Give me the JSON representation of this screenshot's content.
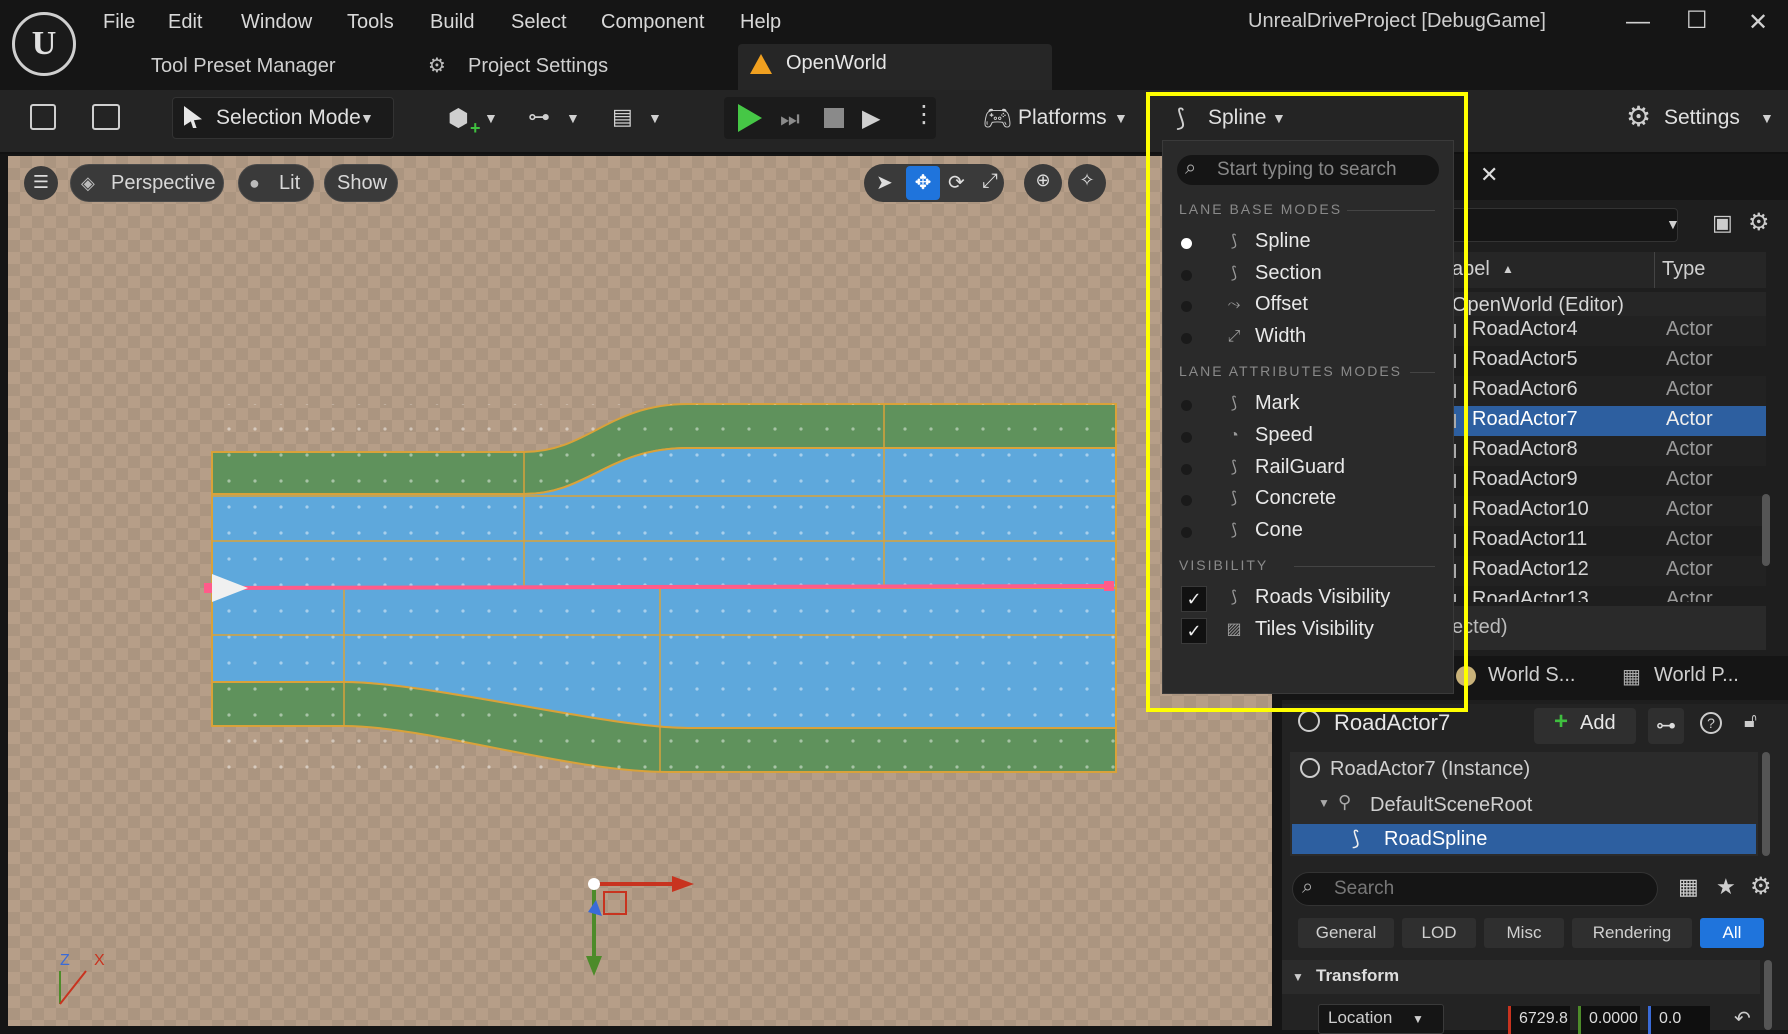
{
  "menu": [
    "File",
    "Edit",
    "Window",
    "Tools",
    "Build",
    "Select",
    "Component",
    "Help"
  ],
  "tabs": {
    "tool_preset": "Tool Preset Manager",
    "project_settings": "Project Settings",
    "openworld": "OpenWorld"
  },
  "window_title": "UnrealDriveProject [DebugGame]",
  "toolbar": {
    "selection_mode": "Selection Mode",
    "platforms": "Platforms",
    "spline": "Spline",
    "settings": "Settings"
  },
  "viewport": {
    "perspective": "Perspective",
    "lit": "Lit",
    "show": "Show",
    "axis_z": "Z",
    "axis_x": "X"
  },
  "spline_menu": {
    "search_placeholder": "Start typing to search",
    "sections": {
      "lane_base": {
        "title": "LANE BASE MODES",
        "items": [
          {
            "label": "Spline",
            "selected": true
          },
          {
            "label": "Section",
            "selected": false
          },
          {
            "label": "Offset",
            "selected": false
          },
          {
            "label": "Width",
            "selected": false
          }
        ]
      },
      "lane_attributes": {
        "title": "LANE ATTRIBUTES MODES",
        "items": [
          {
            "label": "Mark",
            "selected": false
          },
          {
            "label": "Speed",
            "selected": false
          },
          {
            "label": "RailGuard",
            "selected": false
          },
          {
            "label": "Concrete",
            "selected": false
          },
          {
            "label": "Cone",
            "selected": false
          }
        ]
      },
      "visibility": {
        "title": "VISIBILITY",
        "items": [
          {
            "label": "Roads Visibility",
            "checked": true
          },
          {
            "label": "Tiles Visibility",
            "checked": true
          }
        ]
      }
    }
  },
  "outliner": {
    "col_label": "abel",
    "col_type": "Type",
    "root": "OpenWorld (Editor)",
    "rows": [
      {
        "label": "RoadActor4",
        "type": "Actor"
      },
      {
        "label": "RoadActor5",
        "type": "Actor"
      },
      {
        "label": "RoadActor6",
        "type": "Actor"
      },
      {
        "label": "RoadActor7",
        "type": "Actor"
      },
      {
        "label": "RoadActor8",
        "type": "Actor"
      },
      {
        "label": "RoadActor9",
        "type": "Actor"
      },
      {
        "label": "RoadActor10",
        "type": "Actor"
      },
      {
        "label": "RoadActor11",
        "type": "Actor"
      },
      {
        "label": "RoadActor12",
        "type": "Actor"
      },
      {
        "label": "RoadActor13",
        "type": "Actor"
      }
    ],
    "footer": "ected)",
    "selected_row": "RoadActor7"
  },
  "tabs_world": {
    "world_s": "World S...",
    "world_p": "World P..."
  },
  "details": {
    "actor_name": "RoadActor7",
    "add_label": "Add",
    "tree": [
      "RoadActor7 (Instance)",
      "DefaultSceneRoot",
      "RoadSpline"
    ],
    "search_placeholder": "Search",
    "categories": [
      "General",
      "LOD",
      "Misc",
      "Rendering",
      "All"
    ],
    "active_category": "All",
    "transform_label": "Transform",
    "location_label": "Location",
    "loc_x": "6729.8",
    "loc_y": "0.0000",
    "loc_z": "0.0"
  },
  "colors": {
    "highlight": "#ffff00",
    "selection_blue": "#2d5fa0",
    "accent_all": "#1f74dc",
    "road_green": "#5a8e5a",
    "road_blue": "#5aa5d8",
    "spline": "#ff5b8a"
  }
}
